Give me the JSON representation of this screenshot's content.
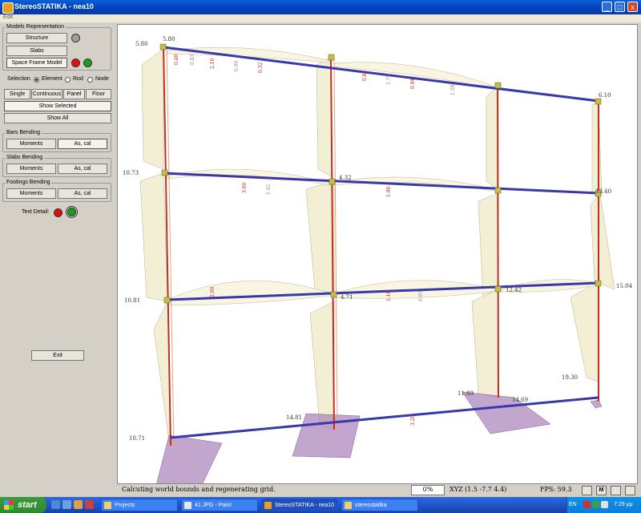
{
  "window": {
    "title": "StereoSTATIKA - nea10",
    "buttons": {
      "minimize": "_",
      "maximize": "□",
      "close": "x"
    }
  },
  "menu": {
    "items": [
      "Edit"
    ]
  },
  "panel": {
    "models": {
      "label": "Models Representation",
      "structure": "Structure",
      "slabs": "Slabs",
      "space_frame": "Space Frame Model"
    },
    "selection": {
      "label": "Selection",
      "options": [
        "Element",
        "Rod",
        "Node"
      ],
      "selected": "Element"
    },
    "select_modes": [
      "Single",
      "Continuous",
      "Panel",
      "Floor"
    ],
    "show_selected": "Show Selected",
    "show_all": "Show All",
    "bars_bending": {
      "label": "Bars Bending",
      "moments": "Moments",
      "as_cal": "As, cal"
    },
    "slabs_bending": {
      "label": "Slabs Bending",
      "moments": "Moments",
      "as_cal": "As, cal"
    },
    "footings_bending": {
      "label": "Footings Bending",
      "moments": "Moments",
      "as_cal": "As, cal"
    },
    "text_detail": "Text Detail:",
    "exit": "Exit",
    "colors": {
      "red": "#e01010",
      "green": "#18a018",
      "gray": "#a0a0a0"
    }
  },
  "viewport": {
    "labels": {
      "left_top": "5.80",
      "left_top2": "5.80",
      "left_mid1": "10.73",
      "left_mid2": "10.81",
      "left_bottom": "10.71",
      "right_r1": "6.10",
      "right_r2": "13.40",
      "right_r3": "15.04",
      "right_r4": "19.30",
      "mid_a": "4.32",
      "mid_b": "4.71",
      "mid_c": "12.42",
      "base1": "14.81",
      "base2": "14.69",
      "base3": "11.89"
    }
  },
  "status": {
    "message": "Calcuting world bounds and regenerating grid.",
    "progress": "0%",
    "xyz": "XYZ (1.5 -7.7 4.4)",
    "fps": "FPS: 59.3",
    "icon_m": "M"
  },
  "taskbar": {
    "start": "start",
    "tasks": [
      "Projects",
      "41.JPG - Paint",
      "StereoSTATIKA - nea10",
      "stereostatika"
    ],
    "active_task": "StereoSTATIKA - nea10",
    "lang": "EN",
    "clock": "7:29 μμ"
  }
}
